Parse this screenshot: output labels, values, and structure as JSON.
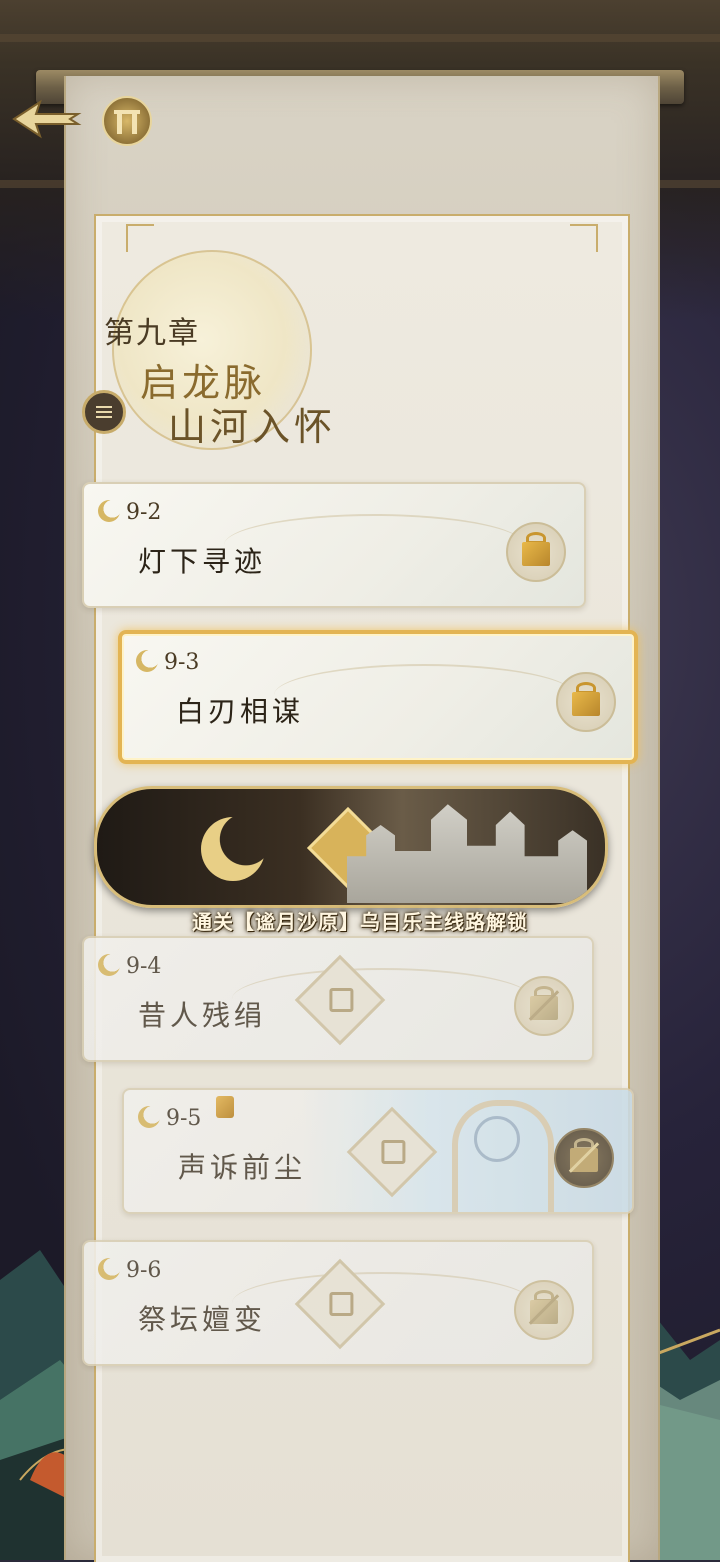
{
  "header": {
    "back_icon": "back-arrow-icon",
    "collection_icon": "pillar-gate-icon"
  },
  "chapter": {
    "number": "第九章",
    "title_line1": "启龙脉",
    "title_line2": "山河入怀"
  },
  "levels": [
    {
      "code": "9-2",
      "name": "灯下寻迹",
      "state": "cleared",
      "reward": "gift-icon"
    },
    {
      "code": "9-3",
      "name": "白刃相谋",
      "state": "current",
      "reward": "gift-icon"
    },
    {
      "code": "9-4",
      "name": "昔人残绢",
      "state": "locked",
      "reward": "gift-locked-icon"
    },
    {
      "code": "9-5",
      "name": "声诉前尘",
      "state": "locked",
      "reward": "gift-locked-icon"
    },
    {
      "code": "9-6",
      "name": "祭坛嬗变",
      "state": "locked",
      "reward": "gift-locked-icon"
    }
  ],
  "banner": {
    "caption": "通关【谧月沙原】乌目乐主线路解锁"
  },
  "colors": {
    "gold_accent": "#e3b453",
    "scroll_paper": "#e5e0d4",
    "ink": "#2c2418"
  }
}
